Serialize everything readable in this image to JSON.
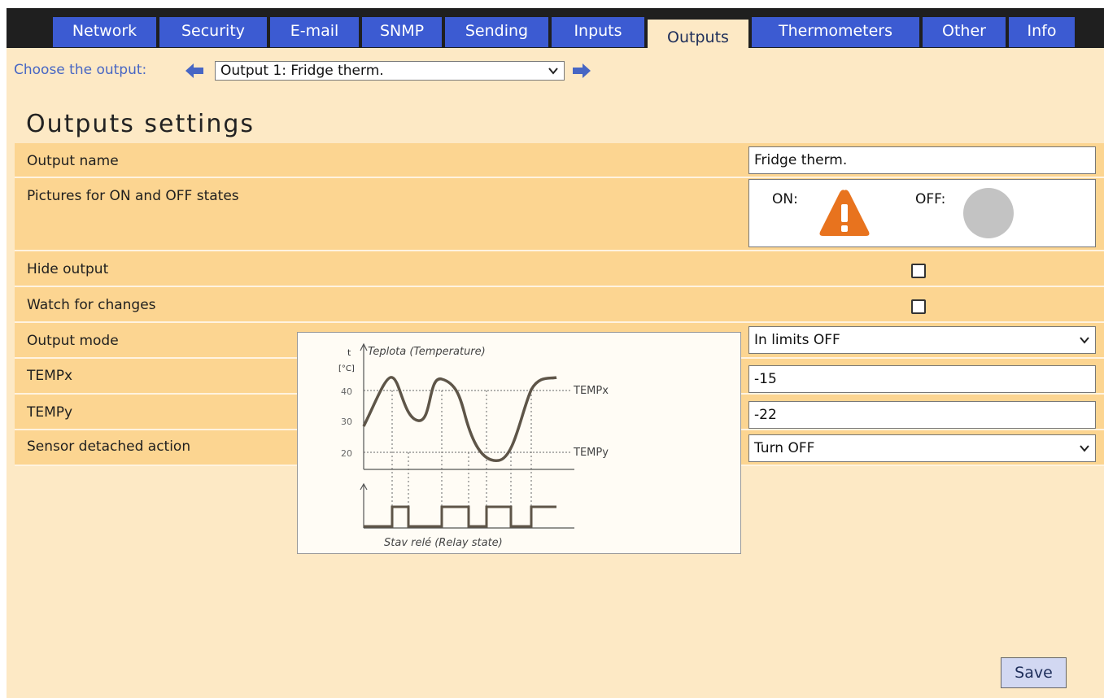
{
  "tabs": [
    {
      "label": "Network"
    },
    {
      "label": "Security"
    },
    {
      "label": "E-mail"
    },
    {
      "label": "SNMP"
    },
    {
      "label": "Sending"
    },
    {
      "label": "Inputs"
    },
    {
      "label": "Outputs",
      "active": true
    },
    {
      "label": "Thermometers"
    },
    {
      "label": "Other"
    },
    {
      "label": "Info"
    }
  ],
  "chooser": {
    "label": "Choose the output:",
    "selected": "Output 1: Fridge therm.",
    "prev_icon": "arrow-left-icon",
    "next_icon": "arrow-right-icon"
  },
  "page": {
    "title": "Outputs settings"
  },
  "fields": {
    "output_name": {
      "label": "Output name",
      "value": "Fridge therm."
    },
    "pictures": {
      "label": "Pictures for ON and OFF states",
      "on_label": "ON:",
      "off_label": "OFF:",
      "on_icon": "warning-triangle-icon",
      "off_icon": "gray-circle-icon"
    },
    "hide_output": {
      "label": "Hide output",
      "checked": false
    },
    "watch_changes": {
      "label": "Watch for changes",
      "checked": false
    },
    "output_mode": {
      "label": "Output mode",
      "value": "In limits OFF"
    },
    "tempx": {
      "label": "TEMPx",
      "value": "-15"
    },
    "tempy": {
      "label": "TEMPy",
      "value": "-22"
    },
    "sensor_detached": {
      "label": "Sensor detached action",
      "value": "Turn OFF"
    }
  },
  "diagram": {
    "t_label": "t",
    "unit_label": "[°C]",
    "title": "Teplota (Temperature)",
    "ticks": [
      "40",
      "30",
      "20"
    ],
    "tempx_label": "TEMPx",
    "tempy_label": "TEMPy",
    "relay_label": "Stav relé (Relay state)"
  },
  "save_label": "Save",
  "colors": {
    "tab_bg": "#3C5BD2",
    "tab_bar": "#1F1F1F",
    "page_bg": "#FDE9C5",
    "row_bg": "#FCD591",
    "warning": "#E8731E"
  }
}
